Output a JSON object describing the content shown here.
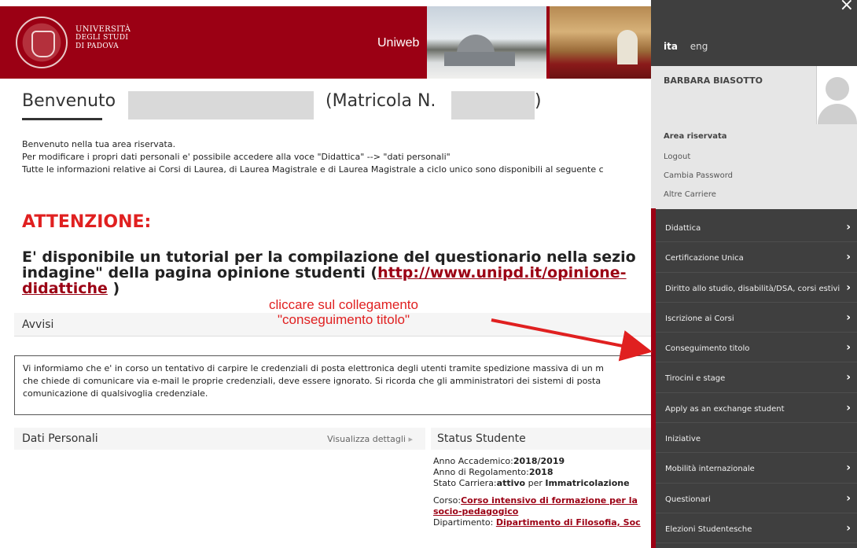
{
  "header": {
    "university_lines": [
      "UNIVERSITÀ",
      "DEGLI STUDI",
      "DI PADOVA"
    ],
    "app_name": "Uniweb"
  },
  "welcome": {
    "greeting": "Benvenuto",
    "matricola_prefix": "(Matricola N.",
    "matricola_suffix": ")"
  },
  "intro_lines": [
    "Benvenuto nella tua area riservata.",
    "Per modificare i propri dati personali e' possibile accedere alla voce \"Didattica\" --> \"dati personali\"",
    "Tutte le informazioni relative ai Corsi di Laurea, di Laurea Magistrale e di Laurea Magistrale a ciclo unico sono disponibili al seguente c"
  ],
  "attention": {
    "title": "ATTENZIONE:",
    "tutorial_text": "E' disponibile un tutorial per la compilazione del questionario nella sezio indagine\" della pagina opinione studenti (",
    "tutorial_link": "http://www.unipd.it/opinione-didattiche",
    "tutorial_end": " )"
  },
  "avvisi": {
    "title": "Avvisi",
    "notice_lines": [
      "Vi informiamo che e' in corso un tentativo di carpire le credenziali di posta elettronica degli utenti tramite spedizione massiva di un m",
      "che chiede di comunicare via e-mail le proprie credenziali, deve essere ignorato. Si ricorda che gli amministratori dei sistemi di posta",
      "comunicazione di qualsivoglia credenziale."
    ]
  },
  "dati_personali": {
    "title": "Dati Personali",
    "link": "Visualizza dettagli"
  },
  "status_studente": {
    "title": "Status Studente",
    "anno_accademico_label": "Anno Accademico:",
    "anno_accademico": "2018/2019",
    "anno_regolamento_label": "Anno di Regolamento:",
    "anno_regolamento": "2018",
    "stato_label": "Stato Carriera:",
    "stato_value": "attivo",
    "stato_per": " per ",
    "stato_tipo": "Immatricolazione",
    "corso_label": "Corso:",
    "corso_value": "Corso intensivo di formazione per la",
    "corso_value2": "socio-pedagogico",
    "dipartimento_label": "Dipartimento: ",
    "dipartimento_value": "Dipartimento di Filosofia, Soc"
  },
  "annotation": {
    "line1": "cliccare sul collegamento",
    "line2": "\"conseguimento titolo\"",
    "color": "#e02020"
  },
  "side_panel": {
    "lang_active": "ita",
    "lang_other": "eng",
    "user_name": "BARBARA BIASOTTO",
    "area_title": "Area riservata",
    "area_links": [
      "Logout",
      "Cambia Password",
      "Altre Carriere"
    ],
    "menu": [
      "Didattica",
      "Certificazione Unica",
      "Diritto allo studio, disabilità/DSA, corsi estivi",
      "Iscrizione ai Corsi",
      "Conseguimento titolo",
      "Tirocini e stage",
      "Apply as an exchange student",
      "Iniziative",
      "Mobilità internazionale",
      "Questionari",
      "Elezioni Studentesche"
    ],
    "menu_has_chevron": [
      true,
      true,
      true,
      true,
      true,
      true,
      true,
      false,
      true,
      true,
      true
    ],
    "close_icon": "close-icon",
    "chevron_icon": "chevron-right-icon"
  },
  "colors": {
    "brand_red": "#9b0014",
    "panel_bg": "#3f3f3f",
    "alert_red": "#e02020"
  }
}
